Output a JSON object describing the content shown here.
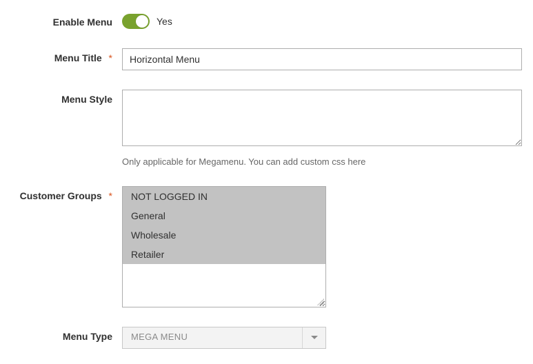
{
  "fields": {
    "enable_menu": {
      "label": "Enable Menu",
      "value_text": "Yes"
    },
    "menu_title": {
      "label": "Menu Title",
      "value": "Horizontal Menu"
    },
    "menu_style": {
      "label": "Menu Style",
      "value": "",
      "hint": "Only applicable for Megamenu. You can add custom css here"
    },
    "customer_groups": {
      "label": "Customer Groups",
      "options": [
        "NOT LOGGED IN",
        "General",
        "Wholesale",
        "Retailer"
      ]
    },
    "menu_type": {
      "label": "Menu Type",
      "value": "MEGA MENU"
    }
  }
}
